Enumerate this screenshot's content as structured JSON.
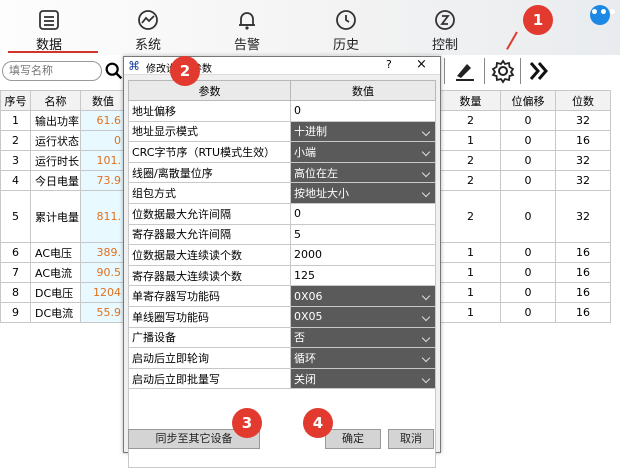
{
  "topnav": {
    "items": [
      {
        "label": "数据",
        "icon": "data-icon"
      },
      {
        "label": "系统",
        "icon": "system-icon"
      },
      {
        "label": "告警",
        "icon": "bell-icon"
      },
      {
        "label": "历史",
        "icon": "history-icon"
      },
      {
        "label": "控制",
        "icon": "control-icon"
      }
    ],
    "help": "•••"
  },
  "toolbar": {
    "search_placeholder": "填写名称"
  },
  "table": {
    "headers": [
      "序号",
      "名称",
      "数值"
    ],
    "rows": [
      {
        "idx": "1",
        "name": "输出功率",
        "value": "61.6"
      },
      {
        "idx": "2",
        "name": "运行状态",
        "value": "0"
      },
      {
        "idx": "3",
        "name": "运行时长",
        "value": "101."
      },
      {
        "idx": "4",
        "name": "今日电量",
        "value": "73.9"
      },
      {
        "idx": "5",
        "name": "累计电量",
        "value": "811."
      },
      {
        "idx": "6",
        "name": "AC电压",
        "value": "389."
      },
      {
        "idx": "7",
        "name": "AC电流",
        "value": "90.5"
      },
      {
        "idx": "8",
        "name": "DC电压",
        "value": "1204"
      },
      {
        "idx": "9",
        "name": "DC电流",
        "value": "55.9"
      }
    ]
  },
  "right_table": {
    "headers": [
      "数量",
      "位偏移",
      "位数"
    ],
    "rows": [
      [
        "2",
        "0",
        "32"
      ],
      [
        "1",
        "0",
        "16"
      ],
      [
        "2",
        "0",
        "32"
      ],
      [
        "2",
        "0",
        "32"
      ],
      [
        "2",
        "0",
        "32"
      ],
      [
        "1",
        "0",
        "16"
      ],
      [
        "1",
        "0",
        "16"
      ],
      [
        "1",
        "0",
        "16"
      ],
      [
        "1",
        "0",
        "16"
      ]
    ]
  },
  "dialog": {
    "title": "修改设",
    "title_suffix": "参数",
    "help": "?",
    "close": "×",
    "col_param": "参数",
    "col_value": "数值",
    "params": [
      {
        "name": "地址偏移",
        "value": "0",
        "select": false
      },
      {
        "name": "地址显示模式",
        "value": "十进制",
        "select": true
      },
      {
        "name": "CRC字节序（RTU模式生效）",
        "value": "小端",
        "select": true
      },
      {
        "name": "线圈/离散量位序",
        "value": "高位在左",
        "select": true
      },
      {
        "name": "组包方式",
        "value": "按地址大小",
        "select": true
      },
      {
        "name": "位数据最大允许间隔",
        "value": "0",
        "select": false
      },
      {
        "name": "寄存器最大允许间隔",
        "value": "5",
        "select": false
      },
      {
        "name": "位数据最大连续读个数",
        "value": "2000",
        "select": false
      },
      {
        "name": "寄存器最大连续读个数",
        "value": "125",
        "select": false
      },
      {
        "name": "单寄存器写功能码",
        "value": "0X06",
        "select": true
      },
      {
        "name": "单线圈写功能码",
        "value": "0X05",
        "select": true
      },
      {
        "name": "广播设备",
        "value": "否",
        "select": true
      },
      {
        "name": "启动后立即轮询",
        "value": "循环",
        "select": true
      },
      {
        "name": "启动后立即批量写",
        "value": "关闭",
        "select": true
      }
    ],
    "sync_button": "同步至其它设备",
    "ok_button": "确定",
    "cancel_button": "取消"
  },
  "badges": [
    "1",
    "2",
    "3",
    "4"
  ],
  "colors": {
    "badge": "#e23a2e",
    "select_bg": "#5a5a5a",
    "value_text": "#e07020",
    "value_bg": "#e8faff"
  }
}
